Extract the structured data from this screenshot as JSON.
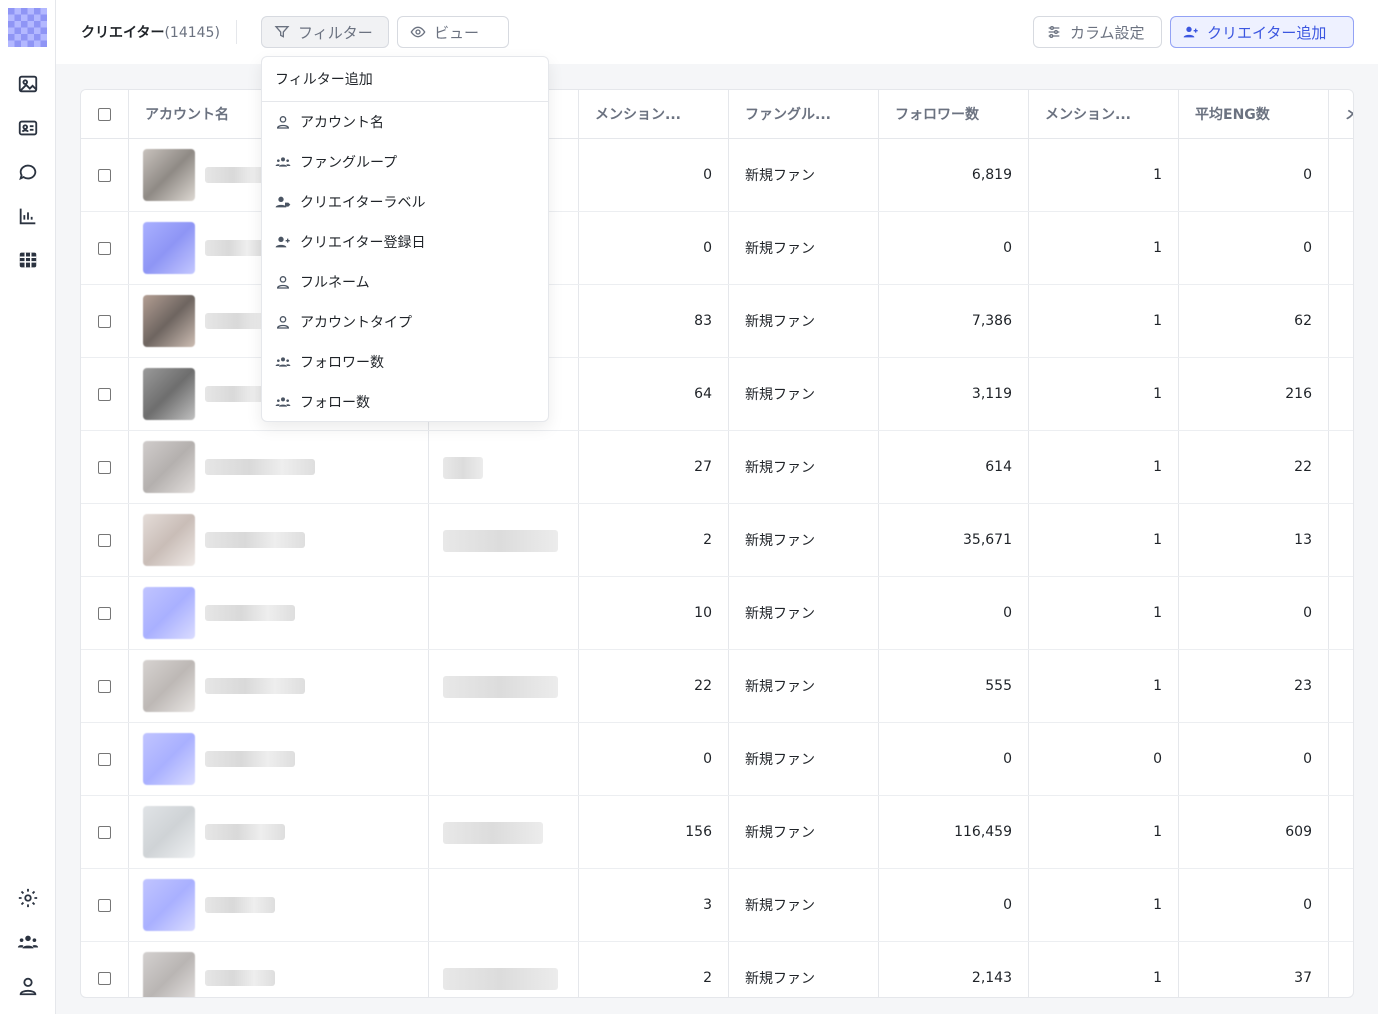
{
  "header": {
    "title": "クリエイター",
    "count": "(14145)",
    "filter_label": "フィルター",
    "view_label": "ビュー",
    "column_settings_label": "カラム設定",
    "add_creator_label": "クリエイター追加"
  },
  "table": {
    "headers": [
      "アカウント名",
      "メンション...",
      "ファングル...",
      "フォロワー数",
      "メンション...",
      "平均ENG数",
      "メ"
    ],
    "rows": [
      {
        "mention": "0",
        "fan_group": "新規ファン",
        "followers": "6,819",
        "mention2": "1",
        "avg_eng": "0"
      },
      {
        "mention": "0",
        "fan_group": "新規ファン",
        "followers": "0",
        "mention2": "1",
        "avg_eng": "0"
      },
      {
        "mention": "83",
        "fan_group": "新規ファン",
        "followers": "7,386",
        "mention2": "1",
        "avg_eng": "62"
      },
      {
        "mention": "64",
        "fan_group": "新規ファン",
        "followers": "3,119",
        "mention2": "1",
        "avg_eng": "216"
      },
      {
        "mention": "27",
        "fan_group": "新規ファン",
        "followers": "614",
        "mention2": "1",
        "avg_eng": "22"
      },
      {
        "mention": "2",
        "fan_group": "新規ファン",
        "followers": "35,671",
        "mention2": "1",
        "avg_eng": "13"
      },
      {
        "mention": "10",
        "fan_group": "新規ファン",
        "followers": "0",
        "mention2": "1",
        "avg_eng": "0"
      },
      {
        "mention": "22",
        "fan_group": "新規ファン",
        "followers": "555",
        "mention2": "1",
        "avg_eng": "23"
      },
      {
        "mention": "0",
        "fan_group": "新規ファン",
        "followers": "0",
        "mention2": "0",
        "avg_eng": "0"
      },
      {
        "mention": "156",
        "fan_group": "新規ファン",
        "followers": "116,459",
        "mention2": "1",
        "avg_eng": "609"
      },
      {
        "mention": "3",
        "fan_group": "新規ファン",
        "followers": "0",
        "mention2": "1",
        "avg_eng": "0"
      },
      {
        "mention": "2",
        "fan_group": "新規ファン",
        "followers": "2,143",
        "mention2": "1",
        "avg_eng": "37"
      }
    ]
  },
  "filter_dropdown": {
    "title": "フィルター追加",
    "items": [
      {
        "label": "アカウント名",
        "icon": "user-icon"
      },
      {
        "label": "ファングループ",
        "icon": "users-icon"
      },
      {
        "label": "クリエイターラベル",
        "icon": "user-tag-icon"
      },
      {
        "label": "クリエイター登録日",
        "icon": "user-plus-icon"
      },
      {
        "label": "フルネーム",
        "icon": "user-icon"
      },
      {
        "label": "アカウントタイプ",
        "icon": "user-icon"
      },
      {
        "label": "フォロワー数",
        "icon": "users-icon"
      },
      {
        "label": "フォロー数",
        "icon": "users-icon"
      }
    ]
  },
  "colors": {
    "accent": "#3b56e0",
    "accent_bg": "#eef1ff",
    "icon": "#2b3340"
  }
}
